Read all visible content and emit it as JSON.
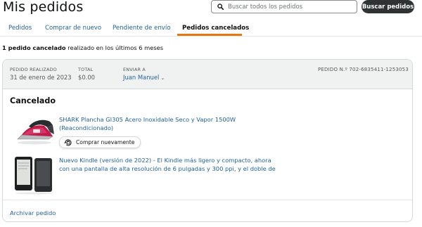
{
  "page": {
    "title": "Mis pedidos"
  },
  "search": {
    "placeholder": "Buscar todos los pedidos",
    "button_label": "Buscar pedidos"
  },
  "tabs": [
    {
      "label": "Pedidos",
      "active": false
    },
    {
      "label": "Comprar de nuevo",
      "active": false
    },
    {
      "label": "Pendiente de envío",
      "active": false
    },
    {
      "label": "Pedidos cancelados",
      "active": true
    }
  ],
  "summary": {
    "count_text": "1 pedido cancelado",
    "rest_text": " realizado en los últimos 6 meses"
  },
  "order": {
    "placed_label": "PEDIDO REALIZADO",
    "placed_value": "31 de enero de 2023",
    "total_label": "TOTAL",
    "total_value": "$0.00",
    "ship_label": "ENVIAR A",
    "ship_value": "Juan Manuel",
    "order_number_text": "PEDIDO N.º 702-6835411-1253053",
    "status": "Cancelado",
    "items": [
      {
        "title": "SHARK Plancha GI305 Acero Inoxidable Seco y Vapor 1500W (Reacondicionado)",
        "image": "steam-iron-image",
        "buy_again_label": "Comprar nuevamente"
      },
      {
        "title": "Nuevo Kindle (versión de 2022) - El Kindle más ligero y compacto, ahora con una pantalla de alta resolución de 6 pulgadas y 300 ppi, y el doble de",
        "image": "kindle-image"
      }
    ],
    "archive_label": "Archivar pedido"
  },
  "colors": {
    "link": "#2162a1",
    "active_tab_underline": "#e47911",
    "search_button": "#303333",
    "header_bg": "#f0f2f2"
  }
}
